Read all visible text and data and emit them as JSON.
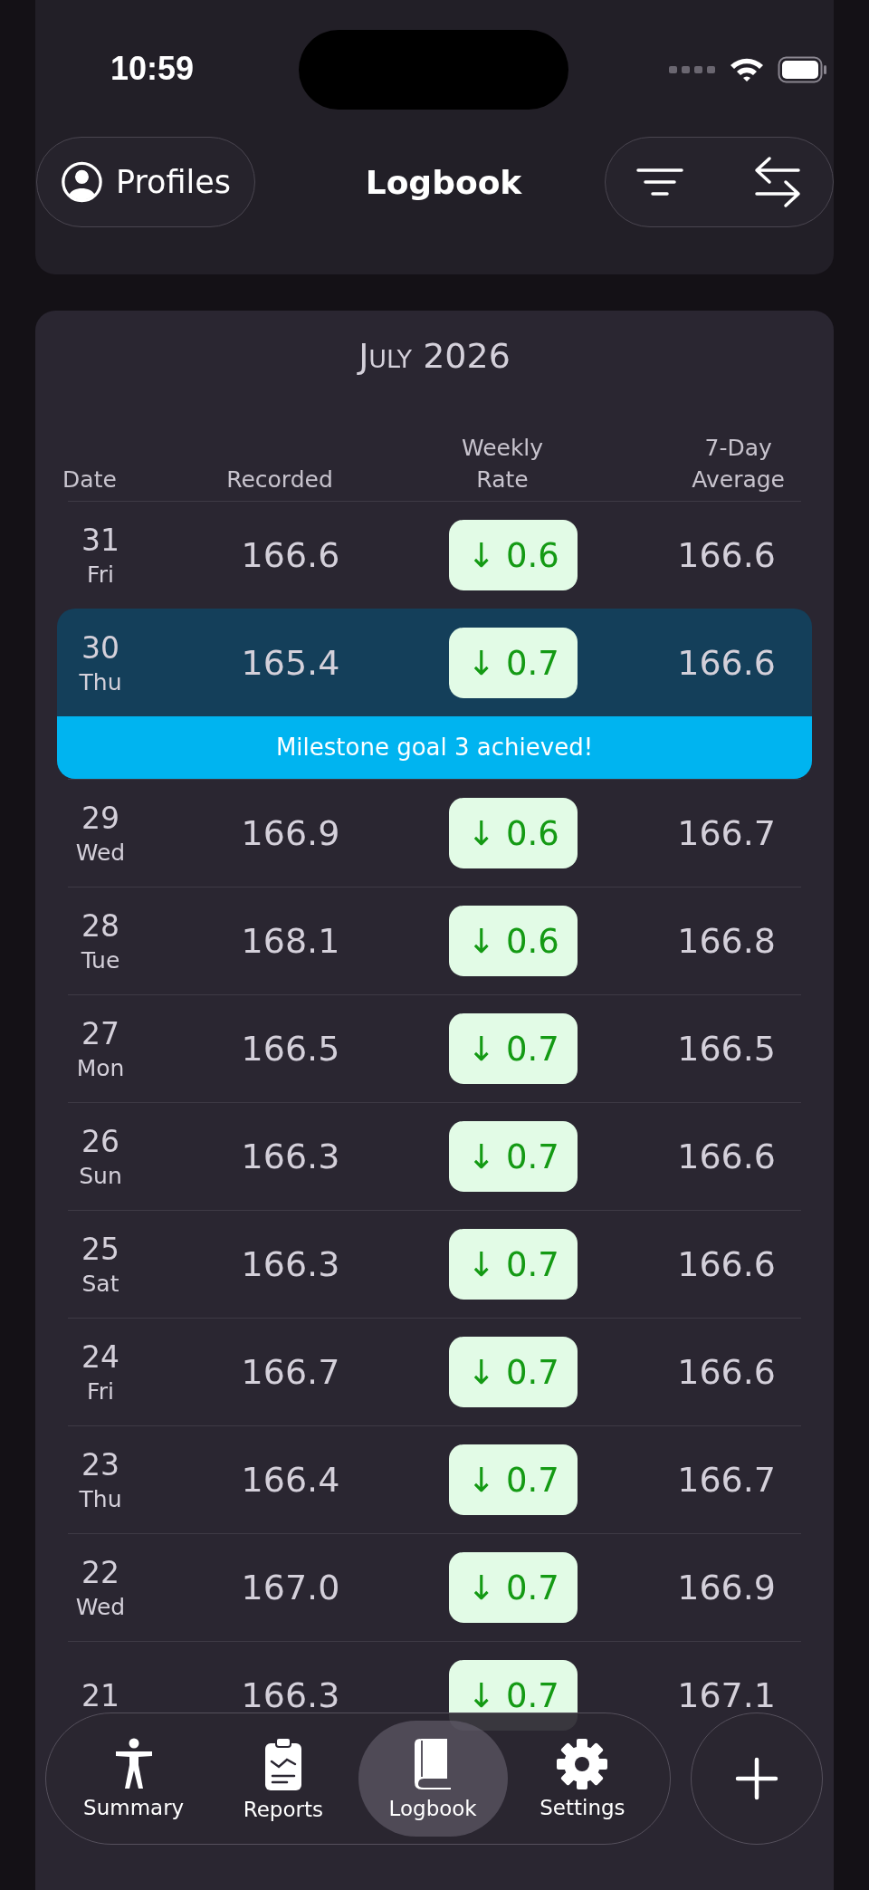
{
  "status_bar": {
    "time": "10:59"
  },
  "header": {
    "profiles_button": "Profiles",
    "title": "Logbook"
  },
  "month": {
    "title": "July 2026",
    "columns": [
      "Date",
      "Recorded",
      "Weekly\nRate",
      "7-Day\nAverage"
    ],
    "rows": [
      {
        "day": "31",
        "weekday": "Fri",
        "recorded": "166.6",
        "rate": "↓ 0.6",
        "average": "166.6",
        "highlighted": false
      },
      {
        "day": "30",
        "weekday": "Thu",
        "recorded": "165.4",
        "rate": "↓ 0.7",
        "average": "166.6",
        "highlighted": true,
        "milestone": "Milestone goal 3 achieved!"
      },
      {
        "day": "29",
        "weekday": "Wed",
        "recorded": "166.9",
        "rate": "↓ 0.6",
        "average": "166.7",
        "highlighted": false
      },
      {
        "day": "28",
        "weekday": "Tue",
        "recorded": "168.1",
        "rate": "↓ 0.6",
        "average": "166.8",
        "highlighted": false
      },
      {
        "day": "27",
        "weekday": "Mon",
        "recorded": "166.5",
        "rate": "↓ 0.7",
        "average": "166.5",
        "highlighted": false
      },
      {
        "day": "26",
        "weekday": "Sun",
        "recorded": "166.3",
        "rate": "↓ 0.7",
        "average": "166.6",
        "highlighted": false
      },
      {
        "day": "25",
        "weekday": "Sat",
        "recorded": "166.3",
        "rate": "↓ 0.7",
        "average": "166.6",
        "highlighted": false
      },
      {
        "day": "24",
        "weekday": "Fri",
        "recorded": "166.7",
        "rate": "↓ 0.7",
        "average": "166.6",
        "highlighted": false
      },
      {
        "day": "23",
        "weekday": "Thu",
        "recorded": "166.4",
        "rate": "↓ 0.7",
        "average": "166.7",
        "highlighted": false
      },
      {
        "day": "22",
        "weekday": "Wed",
        "recorded": "167.0",
        "rate": "↓ 0.7",
        "average": "166.9",
        "highlighted": false
      },
      {
        "day": "21",
        "recorded": "166.3",
        "rate": "↓ 0.7",
        "average": "167.1",
        "highlighted": false
      }
    ]
  },
  "tab_bar": {
    "tabs": [
      {
        "label": "Summary",
        "selected": false
      },
      {
        "label": "Reports",
        "selected": false
      },
      {
        "label": "Logbook",
        "selected": true
      },
      {
        "label": "Settings",
        "selected": false
      }
    ]
  }
}
